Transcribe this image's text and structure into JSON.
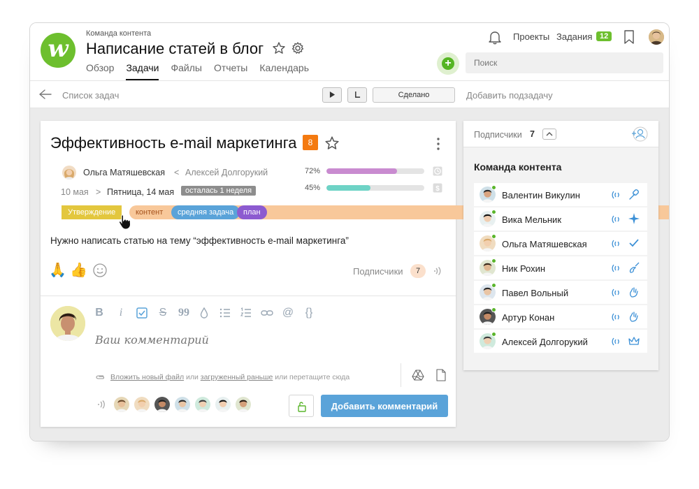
{
  "header": {
    "team_crumb": "Команда контента",
    "project_title": "Написание статей в блог",
    "tabs": [
      {
        "label": "Обзор",
        "active": false
      },
      {
        "label": "Задачи",
        "active": true
      },
      {
        "label": "Файлы",
        "active": false
      },
      {
        "label": "Отчеты",
        "active": false
      },
      {
        "label": "Календарь",
        "active": false
      }
    ],
    "projects_link": "Проекты",
    "tasks_link": "Задания",
    "tasks_badge": "12",
    "search_placeholder": "Поиск"
  },
  "toolbar": {
    "back_label": "Список задач",
    "done_label": "Сделано",
    "add_subtask_label": "Добавить подзадачу"
  },
  "task": {
    "title": "Эффективность e-mail маркетинга",
    "priority": "8",
    "assignee": "Ольга Матяшевская",
    "arrow_lt": "<",
    "author": "Алексей Долгорукий",
    "date_start": "10 мая",
    "arrow_gt": ">",
    "date_end": "Пятница, 14 мая",
    "remaining": "осталась 1 неделя",
    "progress": [
      {
        "label": "72%",
        "value": 72,
        "color": "#c98bd0"
      },
      {
        "label": "45%",
        "value": 45,
        "color": "#6ed3c6"
      }
    ],
    "tags": [
      {
        "label": "Утверждение",
        "kind": "approve"
      },
      {
        "label": "контент",
        "kind": "content"
      },
      {
        "label": "средняя задача",
        "kind": "mid"
      },
      {
        "label": "план",
        "kind": "plan"
      }
    ],
    "description": "Нужно написать статью на тему “эффективность e-mail маркетинга”",
    "subscribers_label": "Подписчики",
    "subscribers_count": "7"
  },
  "comment": {
    "placeholder": "Ваш комментарий",
    "attach_new": "Вложить новый файл",
    "attach_or": "или",
    "attach_uploaded": "загруженный раньше",
    "attach_drag": "или перетащите сюда",
    "submit_label": "Добавить комментарий"
  },
  "panel": {
    "subscribers_label": "Подписчики",
    "subscribers_count": "7",
    "team_title": "Команда контента",
    "members": [
      {
        "name": "Валентин Викулин",
        "role_icon": "wrench-icon"
      },
      {
        "name": "Вика Мельник",
        "role_icon": "sparkle-icon"
      },
      {
        "name": "Ольга Матяшевская",
        "role_icon": "check-icon"
      },
      {
        "name": "Ник Рохин",
        "role_icon": "guitar-icon"
      },
      {
        "name": "Павел Вольный",
        "role_icon": "hand-icon"
      },
      {
        "name": "Артур Конан",
        "role_icon": "hand-icon"
      },
      {
        "name": "Алексей Долгорукий",
        "role_icon": "crown-icon"
      }
    ]
  },
  "colors": {
    "brand_green": "#6dbf2e",
    "accent_blue": "#5aa3d9",
    "priority_orange": "#f47a10"
  }
}
